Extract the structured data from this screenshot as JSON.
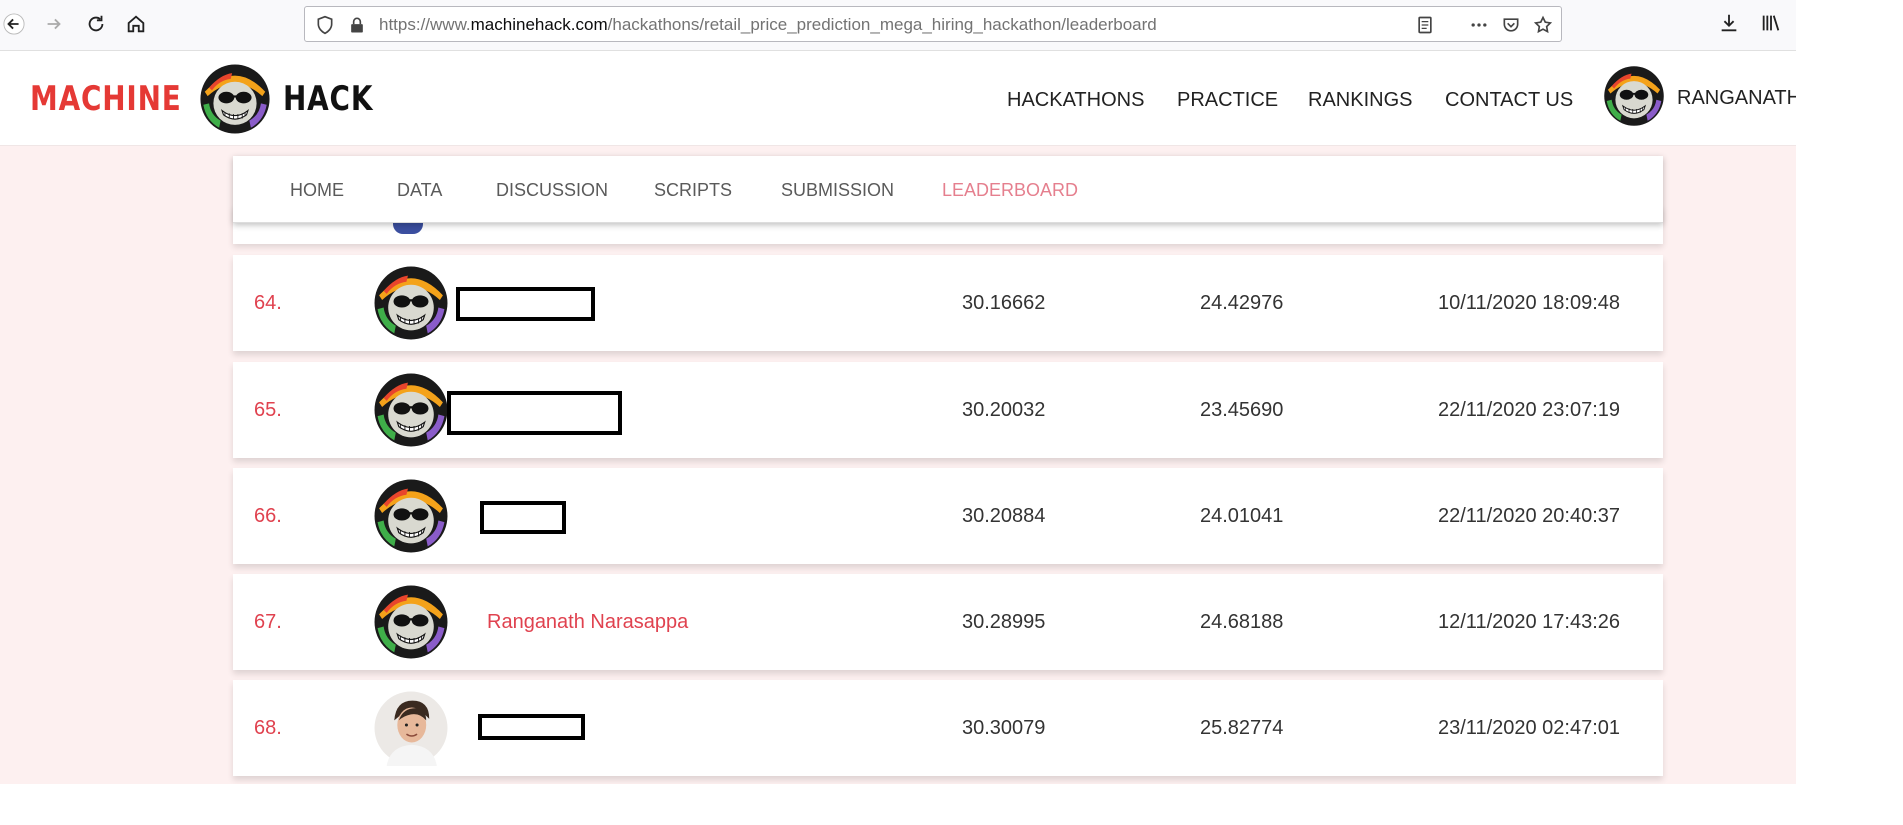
{
  "browser": {
    "url_prefix": "https://www.",
    "url_host": "machinehack.com",
    "url_path": "/hackathons/retail_price_prediction_mega_hiring_hackathon/leaderboard",
    "icons": [
      "back-arrow-icon",
      "forward-arrow-icon",
      "reload-icon",
      "home-icon",
      "shield-icon",
      "lock-icon",
      "reader-view-icon",
      "more-icon",
      "pocket-icon",
      "star-icon",
      "download-icon",
      "library-icon"
    ]
  },
  "header": {
    "logo_left": "MACHINE",
    "logo_right": "HACK",
    "nav": [
      "HACKATHONS",
      "PRACTICE",
      "RANKINGS",
      "CONTACT US"
    ],
    "user_name": "RANGANATH"
  },
  "subnav": {
    "tabs": [
      "HOME",
      "DATA",
      "DISCUSSION",
      "SCRIPTS",
      "SUBMISSION",
      "LEADERBOARD"
    ],
    "active_tab": "LEADERBOARD"
  },
  "leaderboard": {
    "rows": [
      {
        "rank": "64.",
        "name": "",
        "redacted": true,
        "avatar": "helmet-mascot",
        "score_private": "30.16662",
        "score_public": "24.42976",
        "submitted": "10/11/2020 18:09:48"
      },
      {
        "rank": "65.",
        "name": "",
        "redacted": true,
        "avatar": "helmet-mascot",
        "score_private": "30.20032",
        "score_public": "23.45690",
        "submitted": "22/11/2020 23:07:19"
      },
      {
        "rank": "66.",
        "name": "",
        "redacted": true,
        "avatar": "helmet-mascot",
        "score_private": "30.20884",
        "score_public": "24.01041",
        "submitted": "22/11/2020 20:40:37"
      },
      {
        "rank": "67.",
        "name": "Ranganath Narasappa",
        "redacted": false,
        "avatar": "helmet-mascot",
        "score_private": "30.28995",
        "score_public": "24.68188",
        "submitted": "12/11/2020 17:43:26"
      },
      {
        "rank": "68.",
        "name": "",
        "redacted": true,
        "avatar": "user-photo",
        "score_private": "30.30079",
        "score_public": "25.82774",
        "submitted": "23/11/2020 02:47:01"
      }
    ]
  },
  "colors": {
    "accent_red": "#e0424f",
    "active_tab": "#e57f8e",
    "page_bg": "#fdf0f0"
  }
}
